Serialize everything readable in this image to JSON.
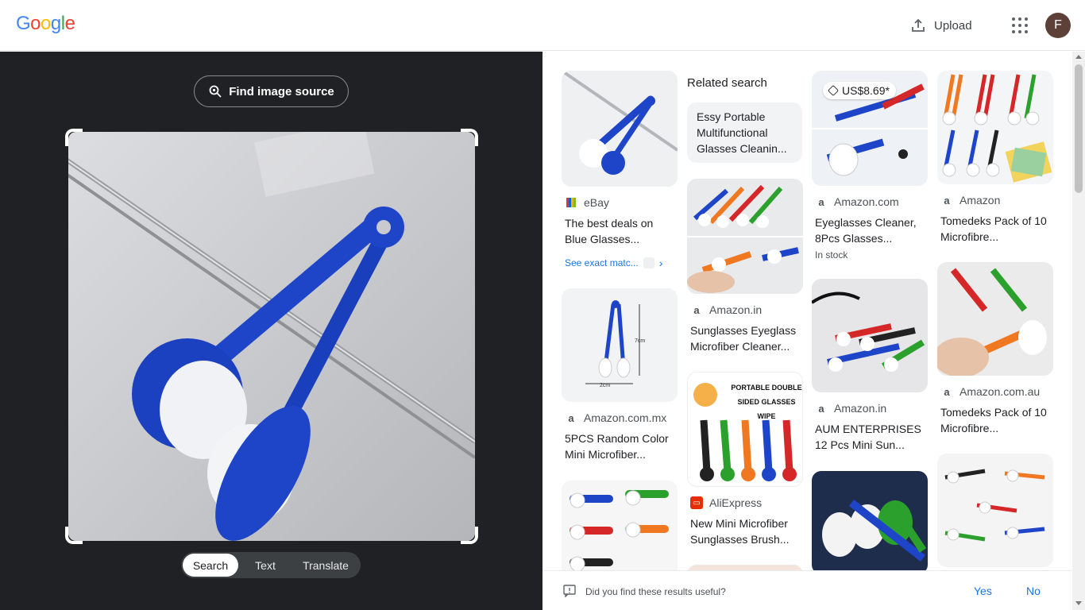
{
  "header": {
    "logo": [
      "G",
      "o",
      "o",
      "g",
      "l",
      "e"
    ],
    "logo_colors": [
      "#4285f4",
      "#ea4335",
      "#fbbc05",
      "#4285f4",
      "#34a853",
      "#ea4335"
    ],
    "upload_label": "Upload",
    "avatar_initial": "F"
  },
  "left": {
    "find_source_label": "Find image source",
    "tabs": [
      "Search",
      "Text",
      "Translate"
    ],
    "active_tab": "Search"
  },
  "right": {
    "related_heading": "Related search",
    "related_chip": "Essy Portable Multifunctional Glasses Cleanin...",
    "results": [
      {
        "source": "eBay",
        "title": "The best deals on Blue Glasses...",
        "extra": "See exact matc..."
      },
      {
        "source": "Amazon.com.mx",
        "title": "5PCS Random Color Mini Microfiber..."
      },
      {
        "source": "Amazon.in",
        "title": "Sunglasses Eyeglass Microfiber Cleaner..."
      },
      {
        "source": "AliExpress",
        "title": "New Mini Microfiber Sunglasses Brush...",
        "banner": "PORTABLE DOUBLE SIDED GLASSES WIPE"
      },
      {
        "source": "Amazon.com",
        "title": "Eyeglasses Cleaner, 8Pcs Glasses...",
        "price": "US$8.69*",
        "stock": "In stock"
      },
      {
        "source": "Amazon.in",
        "title": "AUM ENTERPRISES 12 Pcs Mini Sun..."
      },
      {
        "source": "Amazon",
        "title": "Tomedeks Pack of 10 Microfibre..."
      },
      {
        "source": "Amazon.com.au",
        "title": "Tomedeks Pack of 10 Microfibre..."
      }
    ],
    "dims": {
      "height": "7cm",
      "width": "2cm"
    }
  },
  "footer": {
    "question": "Did you find these results useful?",
    "yes": "Yes",
    "no": "No"
  },
  "colors": {
    "accent": "#1a73e8",
    "dark_panel": "#202124",
    "clip_blue": "#1e45c8"
  }
}
